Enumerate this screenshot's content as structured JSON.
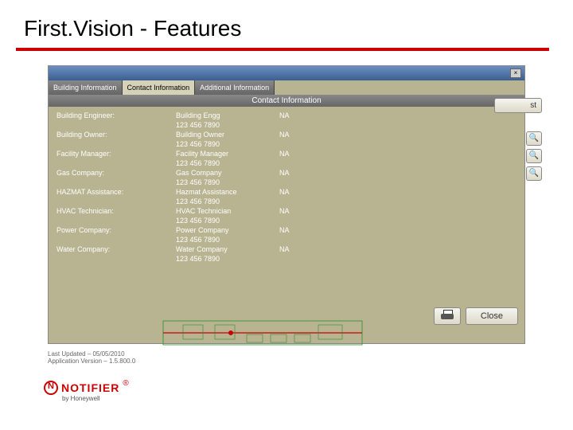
{
  "slide": {
    "title": "First.Vision - Features"
  },
  "tabs": {
    "t0": "Building Information",
    "t1": "Contact Information",
    "t2": "Additional Information"
  },
  "panel": {
    "title": "Contact Information"
  },
  "contacts": [
    {
      "label": "Building Engineer:",
      "name": "Building Engg",
      "phone": "123 456 7890",
      "na": "NA"
    },
    {
      "label": "Building Owner:",
      "name": "Building Owner",
      "phone": "123 456 7890",
      "na": "NA"
    },
    {
      "label": "Facility Manager:",
      "name": "Facility Manager",
      "phone": "123 456 7890",
      "na": "NA"
    },
    {
      "label": "Gas Company:",
      "name": "Gas Company",
      "phone": "123 456 7890",
      "na": "NA"
    },
    {
      "label": "HAZMAT Assistance:",
      "name": "Hazmat Assistance",
      "phone": "123 456 7890",
      "na": "NA"
    },
    {
      "label": "HVAC Technician:",
      "name": "HVAC Technician",
      "phone": "123 456 7890",
      "na": "NA"
    },
    {
      "label": "Power Company:",
      "name": "Power Company",
      "phone": "123 456 7890",
      "na": "NA"
    },
    {
      "label": "Water Company:",
      "name": "Water Company",
      "phone": "123 456 7890",
      "na": "NA"
    }
  ],
  "buttons": {
    "close": "Close"
  },
  "side": {
    "st": "st"
  },
  "status": {
    "updated": "Last Updated – 05/05/2010",
    "version": "Application Version – 1.5.800.0"
  },
  "brand": {
    "name": "NOTIFIER",
    "reg": "®",
    "by": "by Honeywell"
  }
}
